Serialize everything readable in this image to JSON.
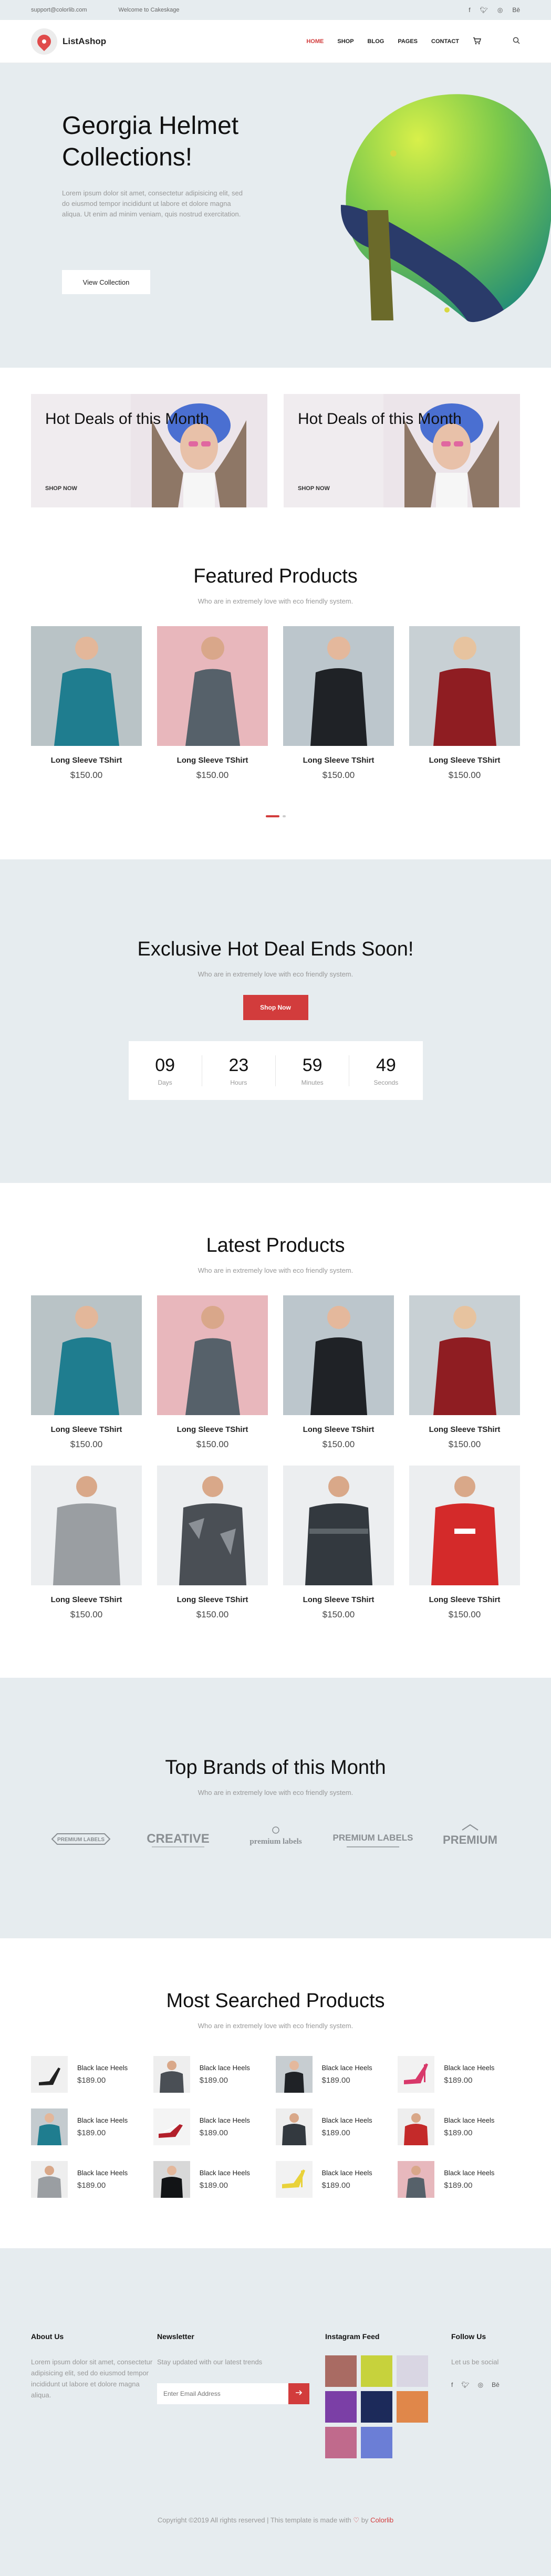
{
  "topbar": {
    "email": "support@colorlib.com",
    "welcome": "Welcome to Cakeskage",
    "social": [
      "f",
      "t",
      "ig",
      "be"
    ]
  },
  "header": {
    "logo": "ListAshop",
    "nav": [
      "HOME",
      "SHOP",
      "BLOG",
      "PAGES",
      "CONTACT"
    ],
    "active": "HOME"
  },
  "hero": {
    "title": "Georgia Helmet Collections!",
    "text": "Lorem ipsum dolor sit amet, consectetur adipisicing elit, sed do eiusmod tempor incididunt ut labore et dolore magna aliqua. Ut enim ad minim veniam, quis nostrud exercitation.",
    "button": "View Collection"
  },
  "deals": [
    {
      "title": "Hot Deals of this Month",
      "link": "SHOP NOW"
    },
    {
      "title": "Hot Deals of this Month",
      "link": "SHOP NOW"
    }
  ],
  "featured": {
    "title": "Featured Products",
    "subtitle": "Who are in extremely love with eco friendly system.",
    "items": [
      {
        "name": "Long Sleeve TShirt",
        "price": "$150.00"
      },
      {
        "name": "Long Sleeve TShirt",
        "price": "$150.00"
      },
      {
        "name": "Long Sleeve TShirt",
        "price": "$150.00"
      },
      {
        "name": "Long Sleeve TShirt",
        "price": "$150.00"
      }
    ]
  },
  "hotdeal": {
    "title": "Exclusive Hot Deal Ends Soon!",
    "subtitle": "Who are in extremely love with eco friendly system.",
    "button": "Shop Now",
    "countdown": [
      {
        "num": "09",
        "label": "Days"
      },
      {
        "num": "23",
        "label": "Hours"
      },
      {
        "num": "59",
        "label": "Minutes"
      },
      {
        "num": "49",
        "label": "Seconds"
      }
    ]
  },
  "latest": {
    "title": "Latest Products",
    "subtitle": "Who are in extremely love with eco friendly system.",
    "items": [
      {
        "name": "Long Sleeve TShirt",
        "price": "$150.00"
      },
      {
        "name": "Long Sleeve TShirt",
        "price": "$150.00"
      },
      {
        "name": "Long Sleeve TShirt",
        "price": "$150.00"
      },
      {
        "name": "Long Sleeve TShirt",
        "price": "$150.00"
      },
      {
        "name": "Long Sleeve TShirt",
        "price": "$150.00"
      },
      {
        "name": "Long Sleeve TShirt",
        "price": "$150.00"
      },
      {
        "name": "Long Sleeve TShirt",
        "price": "$150.00"
      },
      {
        "name": "Long Sleeve TShirt",
        "price": "$150.00"
      }
    ]
  },
  "brands": {
    "title": "Top Brands of this Month",
    "subtitle": "Who are in extremely love with eco friendly system.",
    "logos": [
      "PREMIUM LABELS",
      "CREATIVE",
      "premium labels",
      "PREMIUM LABELS",
      "PREMIUM"
    ]
  },
  "searched": {
    "title": "Most Searched Products",
    "subtitle": "Who are in extremely love with eco friendly system.",
    "items": [
      {
        "name": "Black lace Heels",
        "price": "$189.00"
      },
      {
        "name": "Black lace Heels",
        "price": "$189.00"
      },
      {
        "name": "Black lace Heels",
        "price": "$189.00"
      },
      {
        "name": "Black lace Heels",
        "price": "$189.00"
      },
      {
        "name": "Black lace Heels",
        "price": "$189.00"
      },
      {
        "name": "Black lace Heels",
        "price": "$189.00"
      },
      {
        "name": "Black lace Heels",
        "price": "$189.00"
      },
      {
        "name": "Black lace Heels",
        "price": "$189.00"
      },
      {
        "name": "Black lace Heels",
        "price": "$189.00"
      },
      {
        "name": "Black lace Heels",
        "price": "$189.00"
      },
      {
        "name": "Black lace Heels",
        "price": "$189.00"
      },
      {
        "name": "Black lace Heels",
        "price": "$189.00"
      }
    ]
  },
  "footer": {
    "about_title": "About Us",
    "about_text": "Lorem ipsum dolor sit amet, consectetur adipisicing elit, sed do eiusmod tempor incididunt ut labore et dolore magna aliqua.",
    "news_title": "Newsletter",
    "news_text": "Stay updated with our latest trends",
    "news_placeholder": "Enter Email Address",
    "insta_title": "Instagram Feed",
    "follow_title": "Follow Us",
    "follow_text": "Let us be social",
    "copyright_pre": "Copyright ©2019 All rights reserved | This template is made with",
    "copyright_by": "by",
    "copyright_brand": "Colorlib"
  },
  "colors": {
    "accent": "#d23c3c",
    "panel": "#e6ecef"
  }
}
